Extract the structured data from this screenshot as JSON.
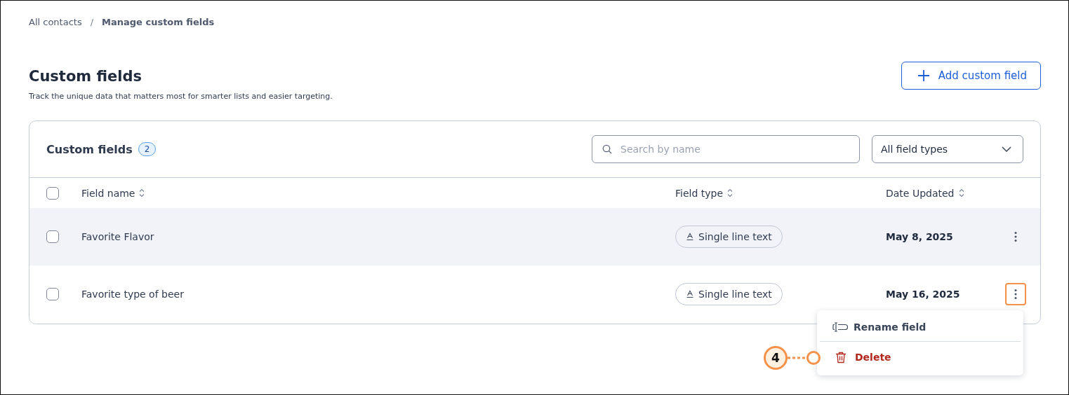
{
  "breadcrumb": [
    {
      "label": "All contacts",
      "current": false
    },
    {
      "label": "Manage custom fields",
      "current": true
    }
  ],
  "breadcrumb_separator": "/",
  "header": {
    "title": "Custom fields",
    "subtitle": "Track the unique data that matters most for smarter lists and easier targeting.",
    "add_button": "Add custom field"
  },
  "panel": {
    "title": "Custom fields",
    "count": "2",
    "search": {
      "placeholder": "Search by name"
    },
    "filter": {
      "value": "All field types"
    }
  },
  "table": {
    "select_all_checked": false,
    "columns": [
      {
        "label": "Field name"
      },
      {
        "label": "Field type"
      },
      {
        "label": "Date Updated"
      }
    ],
    "rows": [
      {
        "name": "Favorite Flavor",
        "type": "Single line text",
        "date": "May 8, 2025",
        "checked": false,
        "hovered": true,
        "menu_open": false
      },
      {
        "name": "Favorite type of beer",
        "type": "Single line text",
        "date": "May 16, 2025",
        "checked": false,
        "hovered": false,
        "menu_open": true
      }
    ]
  },
  "menu": {
    "items": [
      {
        "label": "Rename field",
        "kind": "rename"
      },
      {
        "label": "Delete",
        "kind": "delete"
      }
    ]
  },
  "callout": {
    "number": "4"
  }
}
